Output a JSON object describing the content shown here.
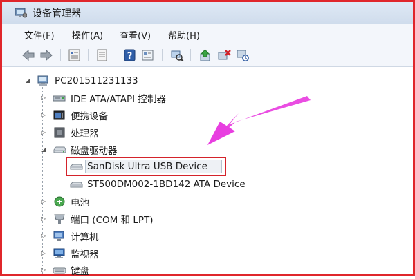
{
  "window": {
    "title": "设备管理器"
  },
  "menu": {
    "items": [
      "文件(F)",
      "操作(A)",
      "查看(V)",
      "帮助(H)"
    ]
  },
  "toolbar": {
    "buttons": [
      "back-icon",
      "forward-icon",
      "properties-icon",
      "help-icon",
      "device-icon",
      "scan-hardware-icon",
      "update-driver-icon",
      "uninstall-icon",
      "disable-icon"
    ]
  },
  "tree": {
    "root": "PC201511231133",
    "categories": [
      {
        "label": "IDE ATA/ATAPI 控制器",
        "icon": "ide-controller-icon"
      },
      {
        "label": "便携设备",
        "icon": "portable-device-icon"
      },
      {
        "label": "处理器",
        "icon": "processor-icon"
      },
      {
        "label": "磁盘驱动器",
        "icon": "disk-drive-icon",
        "expanded": true,
        "children": [
          {
            "label": "SanDisk Ultra USB Device",
            "icon": "usb-drive-icon",
            "selected": true
          },
          {
            "label": "ST500DM002-1BD142 ATA Device",
            "icon": "hard-drive-icon"
          }
        ]
      },
      {
        "label": "电池",
        "icon": "battery-icon"
      },
      {
        "label": "端口 (COM 和 LPT)",
        "icon": "port-icon"
      },
      {
        "label": "计算机",
        "icon": "computer-icon"
      },
      {
        "label": "监视器",
        "icon": "monitor-icon"
      },
      {
        "label": "键盘",
        "icon": "keyboard-icon"
      }
    ]
  },
  "colors": {
    "highlight": "#d4232b",
    "annotation_arrow": "#e83ee0"
  }
}
